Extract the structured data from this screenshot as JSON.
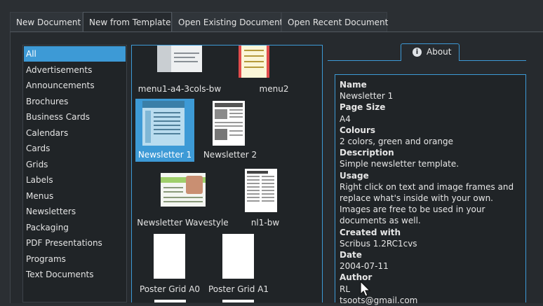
{
  "tabs": [
    "New Document",
    "New from Template",
    "Open Existing Document",
    "Open Recent Document"
  ],
  "active_tab": "New from Template",
  "categories": [
    "All",
    "Advertisements",
    "Announcements",
    "Brochures",
    "Business Cards",
    "Calendars",
    "Cards",
    "Grids",
    "Labels",
    "Menus",
    "Newsletters",
    "Packaging",
    "PDF Presentations",
    "Programs",
    "Text Documents"
  ],
  "selected_category": "All",
  "templates": [
    "menu1-a4-3cols-bw",
    "menu2",
    "Newsletter 1",
    "Newsletter 2",
    "Newsletter Wavestyle",
    "nl1-bw",
    "Poster Grid A0",
    "Poster Grid A1"
  ],
  "selected_template": "Newsletter 1",
  "about": {
    "tab_label": "About",
    "icon": "info-icon",
    "fields": [
      {
        "key": "Name",
        "value": "Newsletter 1"
      },
      {
        "key": "Page Size",
        "value": "A4"
      },
      {
        "key": "Colours",
        "value": "2 colors, green and orange"
      },
      {
        "key": "Description",
        "value": "Simple newsletter template."
      },
      {
        "key": "Usage",
        "value": "Right click on text and image frames and replace what's inside with your own. Images are free to be used in your documents as well."
      },
      {
        "key": "Created with",
        "value": "Scribus 1.2RC1cvs"
      },
      {
        "key": "Date",
        "value": "2004-07-11"
      },
      {
        "key": "Author",
        "value": "RL"
      },
      {
        "key": "",
        "value": "tsoots@gmail.com"
      }
    ]
  },
  "colors": {
    "accent": "#3d9ad6",
    "background": "#2b2f33",
    "panel": "#202427"
  }
}
